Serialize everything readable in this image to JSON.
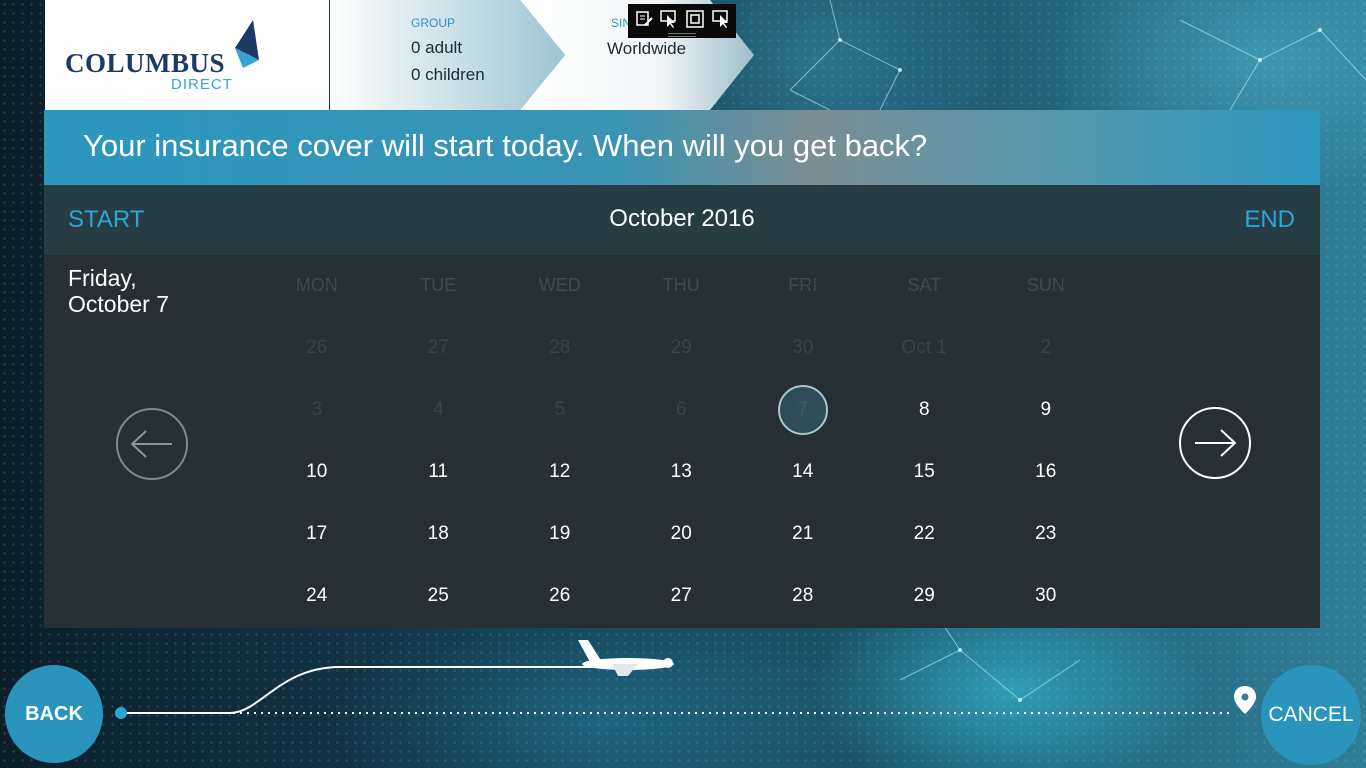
{
  "brand": {
    "name": "COLUMBUS",
    "sub": "DIRECT"
  },
  "breadcrumbs": {
    "group_label": "GROUP",
    "adults": "0 adult",
    "children": "0 children",
    "trip_label": "SIN",
    "trip_value": "Worldwide"
  },
  "question": "Your insurance cover will start today. When will you get back?",
  "calendar": {
    "start_label": "START",
    "end_label": "END",
    "month": "October 2016",
    "selected_line1": "Friday,",
    "selected_line2": "October 7",
    "weekdays": [
      "MON",
      "TUE",
      "WED",
      "THU",
      "FRI",
      "SAT",
      "SUN"
    ],
    "weeks": [
      [
        "26",
        "27",
        "28",
        "29",
        "30",
        "Oct 1",
        "2"
      ],
      [
        "3",
        "4",
        "5",
        "6",
        "7",
        "8",
        "9"
      ],
      [
        "10",
        "11",
        "12",
        "13",
        "14",
        "15",
        "16"
      ],
      [
        "17",
        "18",
        "19",
        "20",
        "21",
        "22",
        "23"
      ],
      [
        "24",
        "25",
        "26",
        "27",
        "28",
        "29",
        "30"
      ]
    ]
  },
  "nav": {
    "prev_icon": "arrow-left-icon",
    "next_icon": "arrow-right-icon"
  },
  "bottom": {
    "back_label": "BACK",
    "cancel_label": "CANCEL"
  },
  "colors": {
    "accent": "#2b94bd",
    "link": "#2aa5dc",
    "panel": "#252f34",
    "panel_header": "#283c44"
  }
}
